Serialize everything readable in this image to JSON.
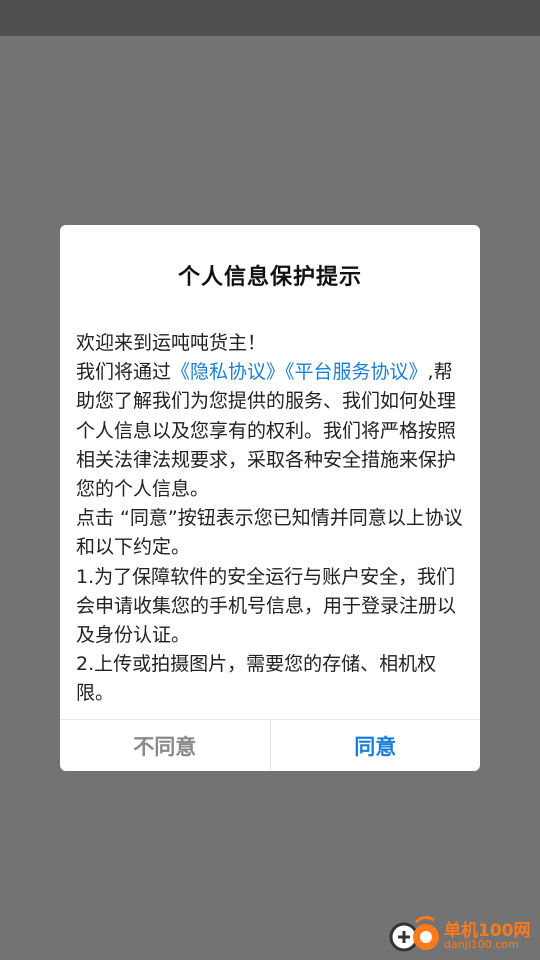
{
  "dialog": {
    "title": "个人信息保护提示",
    "body": {
      "greeting": "欢迎来到运吨吨货主！",
      "p1_prefix": "我们将通过",
      "privacy_link": "《隐私协议》",
      "service_link": "《平台服务协议》",
      "p1_suffix": ",帮助您了解我们为您提供的服务、我们如何处理个人信息以及您享有的权利。我们将严格按照相关法律法规要求，采取各种安全措施来保护您的个人信息。",
      "p2": "点击 “同意”按钮表示您已知情并同意以上协议和以下约定。",
      "p3": "1.为了保障软件的安全运行与账户安全，我们会申请收集您的手机号信息，用于登录注册以及身份认证。",
      "p4": "2.上传或拍摄图片，需要您的存储、相机权限。"
    },
    "decline_label": "不同意",
    "accept_label": "同意"
  },
  "watermark": {
    "brand": "单机100网",
    "url": "danji100.com"
  },
  "colors": {
    "accent": "#1b7ed6",
    "overlay": "#737373",
    "decline": "#8a8a8a",
    "watermark": "#ff7a1a"
  }
}
